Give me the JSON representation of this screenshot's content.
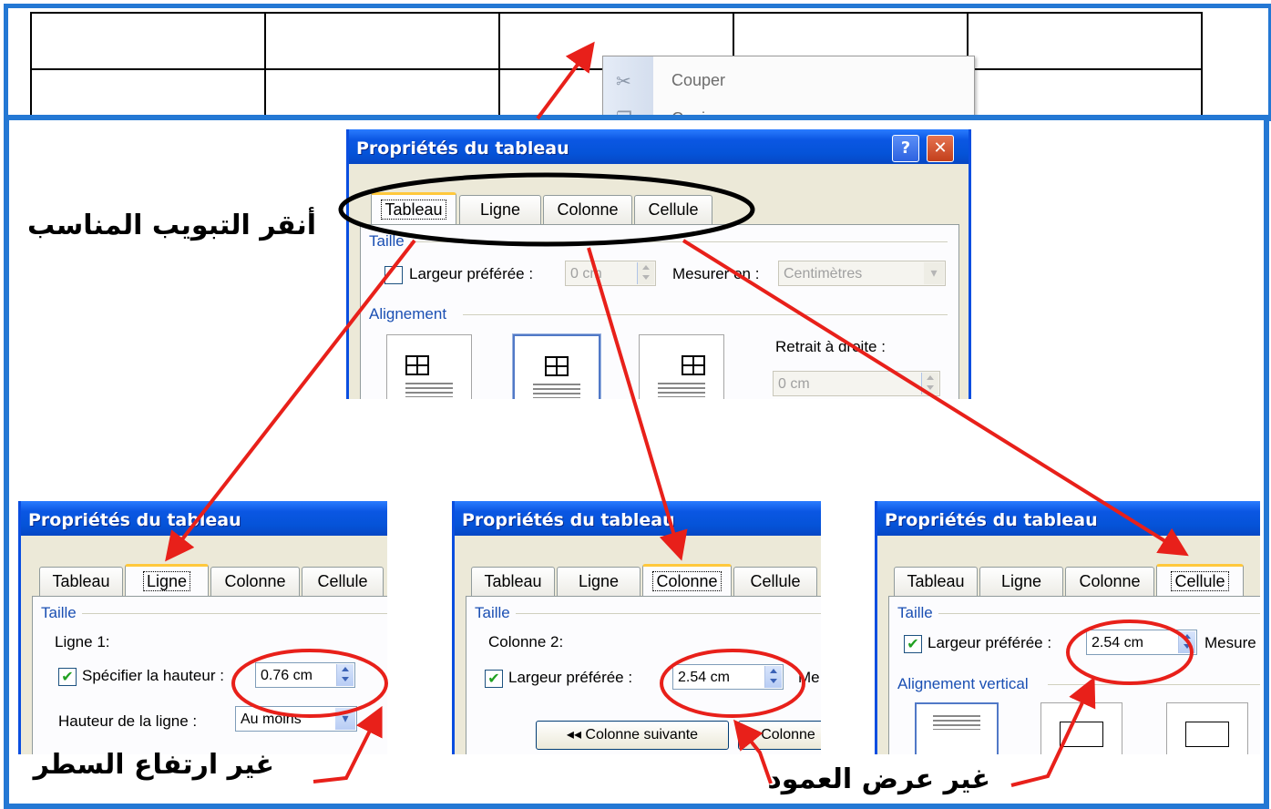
{
  "context_menu": {
    "items": [
      {
        "label": "Couper",
        "icon": "scissors-icon"
      },
      {
        "label": "Copier",
        "icon": "copy-icon"
      }
    ]
  },
  "main_dialog": {
    "title": "Propriétés du tableau",
    "help_label": "?",
    "close_label": "✕",
    "tabs": [
      "Tableau",
      "Ligne",
      "Colonne",
      "Cellule"
    ],
    "active_tab": "Tableau",
    "taille_group": "Taille",
    "preferred_width_label": "Largeur préférée :",
    "preferred_width_value": "0 cm",
    "measure_label": "Mesurer en :",
    "measure_value": "Centimètres",
    "alignment_group": "Alignement",
    "indent_label": "Retrait à droite :",
    "indent_value": "0 cm"
  },
  "row_dialog": {
    "title": "Propriétés du tableau",
    "tabs": [
      "Tableau",
      "Ligne",
      "Colonne",
      "Cellule"
    ],
    "active_tab": "Ligne",
    "taille_group": "Taille",
    "row_label": "Ligne 1:",
    "specify_height_label": "Spécifier la hauteur :",
    "height_value": "0.76 cm",
    "row_height_label": "Hauteur de la ligne :",
    "row_height_mode": "Au moins"
  },
  "column_dialog": {
    "title": "Propriétés du tableau",
    "tabs": [
      "Tableau",
      "Ligne",
      "Colonne",
      "Cellule"
    ],
    "active_tab": "Colonne",
    "taille_group": "Taille",
    "column_label": "Colonne 2:",
    "preferred_width_label": "Largeur préférée :",
    "width_value": "2.54 cm",
    "measure_short": "Me",
    "next_column_button": "◂◂ Colonne suivante",
    "prev_column_button": "Colonne"
  },
  "cell_dialog": {
    "title": "Propriétés du tableau",
    "tabs": [
      "Tableau",
      "Ligne",
      "Colonne",
      "Cellule"
    ],
    "active_tab": "Cellule",
    "taille_group": "Taille",
    "preferred_width_label": "Largeur préférée :",
    "width_value": "2.54 cm",
    "measure_short": "Mesure",
    "vertical_alignment_group": "Alignement vertical"
  },
  "annotations": {
    "click_tab": "أنقر التبويب المناسب",
    "change_row_height": "غير ارتفاع السطر",
    "change_column_width": "غير عرض العمود"
  },
  "colors": {
    "frame_blue": "#2478d4",
    "xp_title_blue": "#0553d8",
    "dialog_bg": "#ece9d8",
    "arrow_red": "#e8201a"
  }
}
